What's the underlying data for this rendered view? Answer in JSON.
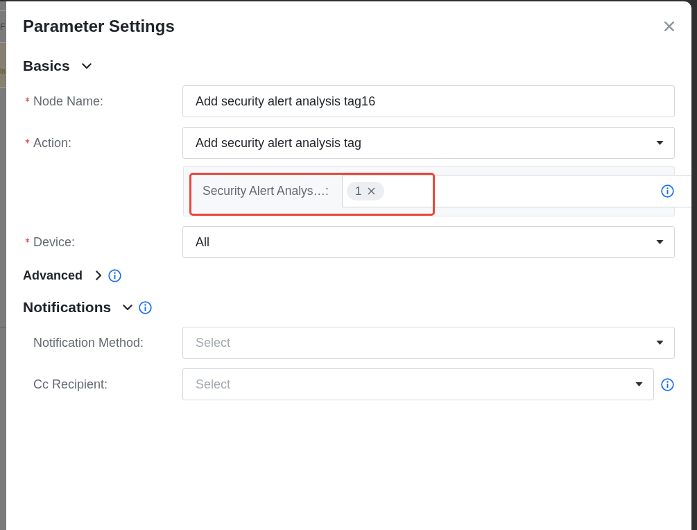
{
  "backdrop": {
    "fragments": [
      "F",
      "is"
    ]
  },
  "dialog": {
    "title": "Parameter Settings"
  },
  "sections": [
    {
      "kind": "section",
      "title": "Basics",
      "expanded": true,
      "info": false,
      "fields": [
        {
          "kind": "text",
          "label": "Node Name:",
          "required": true,
          "highlighted": false,
          "info": false,
          "value": "Add security alert analysis tag16"
        },
        {
          "kind": "select",
          "label": "Action:",
          "required": true,
          "highlighted": false,
          "info": false,
          "value": "Add security alert analysis tag"
        },
        {
          "kind": "tags",
          "label": "Security Alert Analys…:",
          "required": false,
          "highlighted": true,
          "info": true,
          "tags": [
            {
              "label": "1"
            }
          ]
        },
        {
          "kind": "select",
          "label": "Device:",
          "required": true,
          "highlighted": false,
          "info": false,
          "value": "All"
        }
      ]
    },
    {
      "kind": "subsection",
      "title": "Advanced",
      "expanded": false,
      "info": true
    },
    {
      "kind": "section",
      "title": "Notifications",
      "expanded": true,
      "info": true,
      "fields": [
        {
          "kind": "select",
          "label": "Notification Method:",
          "required": false,
          "highlighted": false,
          "info": false,
          "placeholder": "Select"
        },
        {
          "kind": "select",
          "label": "Cc Recipient:",
          "required": false,
          "highlighted": false,
          "info": true,
          "placeholder": "Select"
        }
      ]
    }
  ]
}
